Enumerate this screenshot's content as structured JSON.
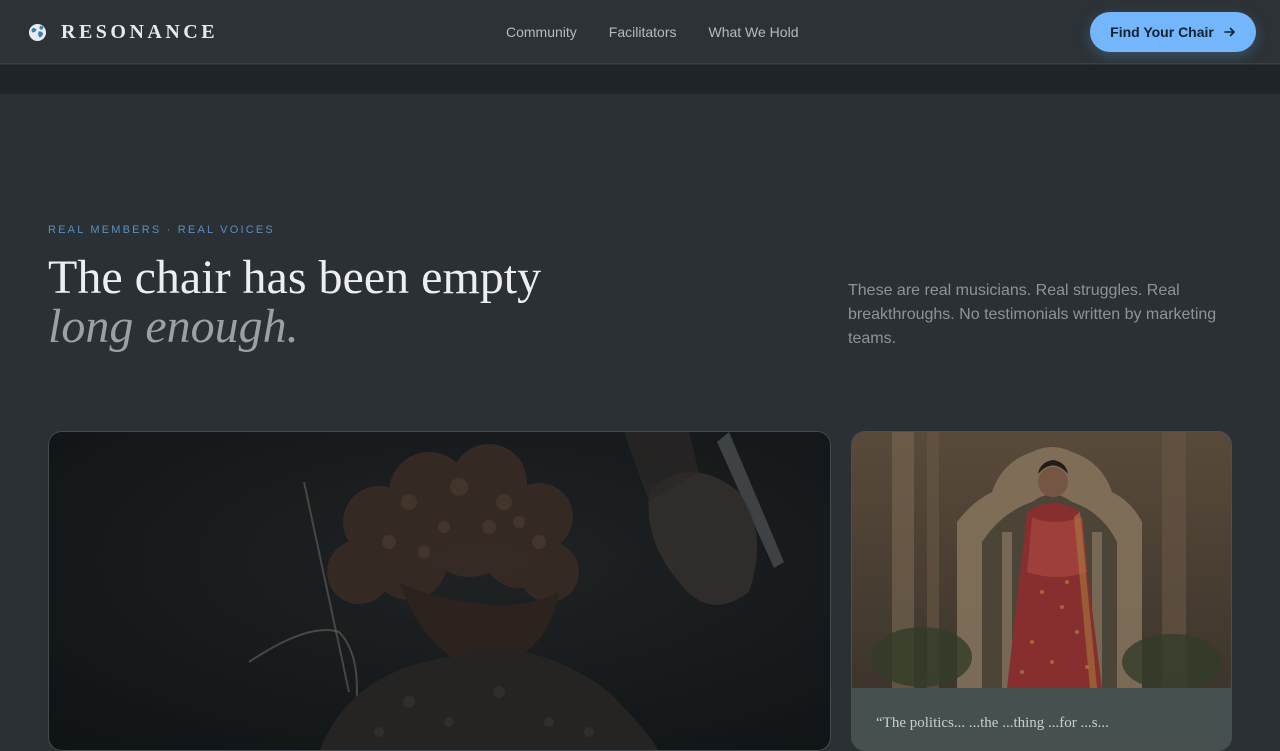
{
  "header": {
    "brand": "RESONANCE",
    "nav": [
      "Community",
      "Facilitators",
      "What We Hold"
    ],
    "cta_label": "Find Your Chair"
  },
  "hero": {
    "eyebrow": "REAL MEMBERS · REAL VOICES",
    "headline": "The chair has been empty",
    "headline_italic": "long enough.",
    "intro": "These are real musicians. Real struggles. Real breakthroughs. No testimonials written by marketing teams."
  },
  "cards": {
    "featured_image": "musician-performing-photo",
    "secondary_image": "woman-in-red-saree-photo",
    "secondary_quote_partial": "“The politics... ...the ...thing ...for ...s..."
  },
  "colors": {
    "accent": "#74b6fb",
    "eyebrow": "#5b8fbf",
    "background": "#2a3034",
    "header": "#2c3236"
  }
}
